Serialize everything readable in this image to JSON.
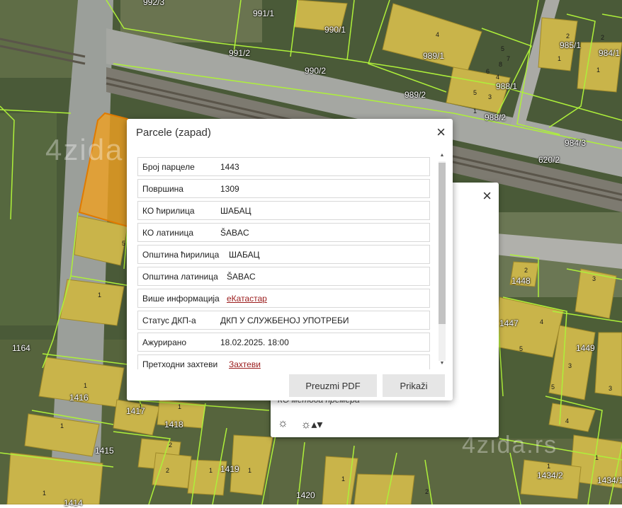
{
  "map": {
    "watermark_top": "4zida",
    "watermark_bottom": "4zida.rs",
    "parcel_numbers": [
      "992/3",
      "991/1",
      "990/1",
      "991/2",
      "990/2",
      "989/1",
      "989/2",
      "988/1",
      "988/2",
      "985/1",
      "984/1",
      "984/3",
      "620/2",
      "1164",
      "1448",
      "1449",
      "1447",
      "1416",
      "1417",
      "1418",
      "1415",
      "1419",
      "1420",
      "1434/2",
      "1434/1",
      "1414"
    ],
    "building_numbers": [
      "4",
      "5",
      "6",
      "7",
      "8",
      "1",
      "2",
      "3",
      "1",
      "2",
      "1",
      "3",
      "4",
      "5",
      "2",
      "1",
      "3",
      "5",
      "1",
      "1",
      "1",
      "1",
      "2",
      "4",
      "1",
      "2",
      "1",
      "1",
      "2",
      "1",
      "1",
      "1"
    ]
  },
  "popup_back": {
    "close_icon": "×",
    "method_text": "КО метода премера",
    "tool1": "☼",
    "tool2": "☼▴▾"
  },
  "popup_front": {
    "title": "Parcele (zapad)",
    "close_icon": "×",
    "rows": [
      {
        "key": "Број парцеле",
        "value": "1443"
      },
      {
        "key": "Површина",
        "value": "1309"
      },
      {
        "key": "КО ћирилица",
        "value": "ШАБАЦ"
      },
      {
        "key": "КО латиница",
        "value": "ŠABAC"
      },
      {
        "key": "Општина ћирилица",
        "value": "ШАБАЦ"
      },
      {
        "key": "Општина латиница",
        "value": "ŠABAC"
      },
      {
        "key": "Више информација",
        "value": "еКатастар"
      },
      {
        "key": "Статус ДКП-а",
        "value": "ДКП У СЛУЖБЕНОЈ УПОТРЕБИ"
      },
      {
        "key": "Ажурирано",
        "value": "18.02.2025. 18:00"
      },
      {
        "key": "Претходни захтеви",
        "value": "Захтеви"
      }
    ],
    "btn_pdf": "Preuzmi PDF",
    "btn_show": "Prikaži",
    "scroll_up": "▲",
    "scroll_down": "▼"
  }
}
